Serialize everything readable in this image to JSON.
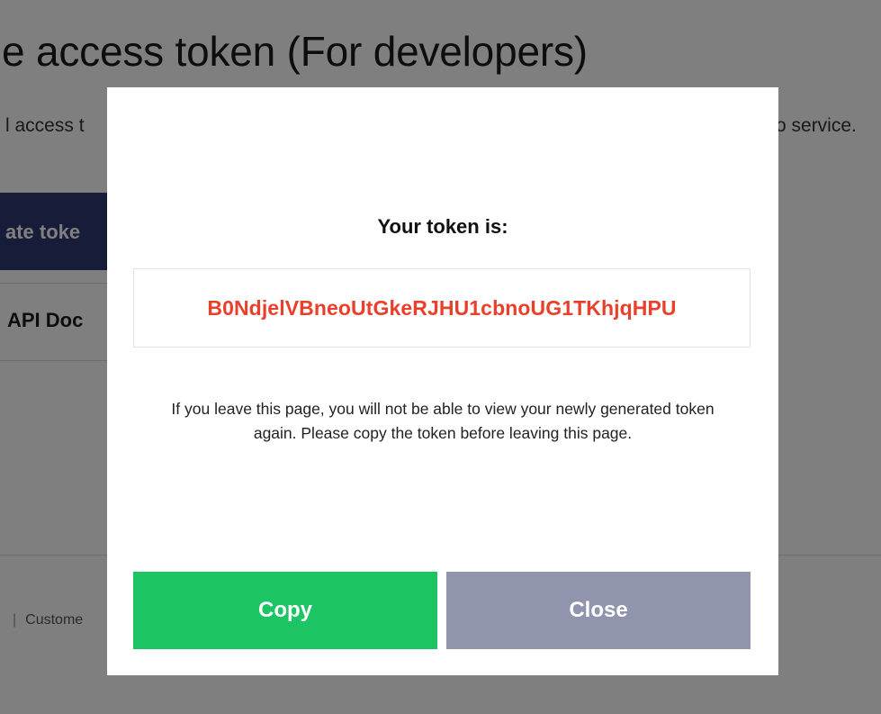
{
  "background": {
    "title": "e access token (For developers)",
    "description_left": "l access t",
    "description_right": "o service.",
    "generate_button_label": "ate toke",
    "api_docs_link": "API Doc",
    "footer_link": "Custome",
    "footer_separator": "|"
  },
  "modal": {
    "title": "Your token is:",
    "token": "B0NdjelVBneoUtGkeRJHU1cbnoUG1TKhjqHPU",
    "warning": "If you leave this page, you will not be able to view your newly generated token again. Please copy the token before leaving this page.",
    "copy_label": "Copy",
    "close_label": "Close"
  },
  "colors": {
    "token_text": "#e8402a",
    "copy_button": "#1dc464",
    "close_button": "#9194ad",
    "overlay": "rgba(0,0,0,0.5)",
    "generate_button": "#2e3a73"
  }
}
